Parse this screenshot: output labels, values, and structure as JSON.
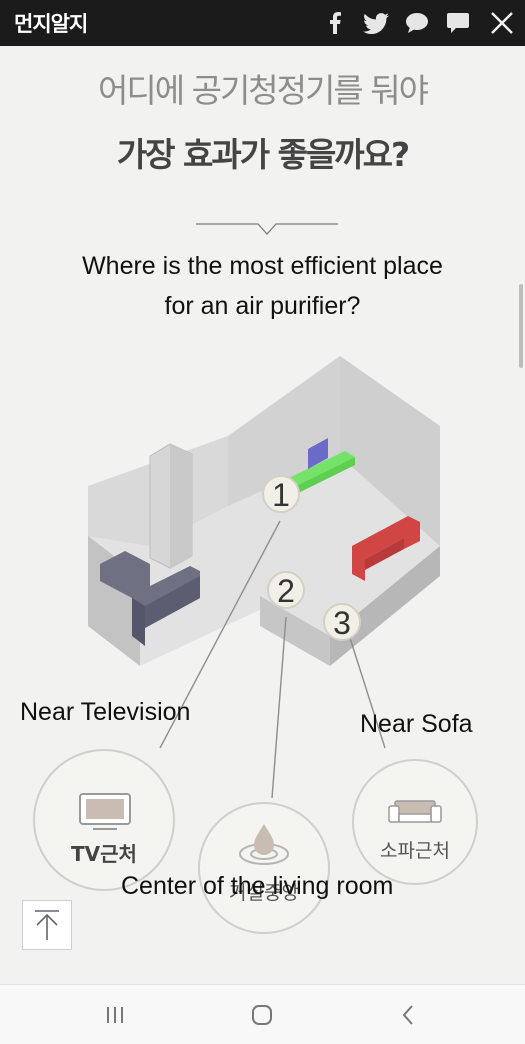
{
  "header": {
    "logo": "먼지알지",
    "icons": [
      "facebook-icon",
      "twitter-icon",
      "kakaostory-icon",
      "kakaotalk-icon",
      "close-icon"
    ]
  },
  "article": {
    "title_line1": "어디에 공기청정기를 둬야",
    "title_line2": "가장 효과가 좋을까요?",
    "question_line1": "Where is the most efficient place",
    "question_line2": "for an air purifier?",
    "markers": [
      "1",
      "2",
      "3"
    ],
    "circles": {
      "tv": "TV근처",
      "center": "거실중앙",
      "sofa": "소파근처"
    },
    "labels": {
      "tv": "Near Television",
      "sofa": "Near Sofa",
      "center": "Center of the living room"
    }
  },
  "colors": {
    "topbar": "#1b1b1b",
    "tv_marker": "#6a6ac8",
    "marker_green": "#5ad24a",
    "sofa_red": "#d24545"
  },
  "navbar": {
    "buttons": [
      "recent-apps-icon",
      "home-icon",
      "back-icon"
    ]
  }
}
